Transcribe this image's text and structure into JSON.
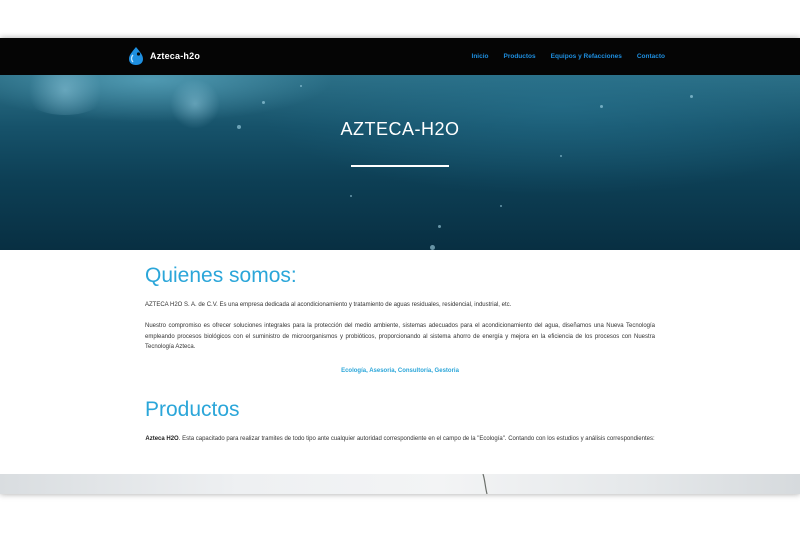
{
  "brand": {
    "name": "Azteca-h2o",
    "logo_icon": "water-drop-logo-icon"
  },
  "nav": {
    "items": [
      {
        "label": "Inicio"
      },
      {
        "label": "Productos"
      },
      {
        "label": "Equipos y Refacciones"
      },
      {
        "label": "Contacto"
      }
    ]
  },
  "hero": {
    "title": "AZTECA-H2O"
  },
  "about": {
    "heading": "Quienes somos:",
    "paragraph1": "AZTECA H2O S. A. de C.V. Es una empresa dedicada al acondicionamiento y tratamiento de aguas residuales, residencial, industrial, etc.",
    "paragraph2": "Nuestro compromiso es ofrecer soluciones integrales para la protección del medio ambiente, sistemas adecuados para el acondicionamiento del agua, diseñamos una Nueva Tecnología empleando procesos biológicos con el suministro de microorganismos y probióticos, proporcionando al sistema ahorro de energía y mejora en la eficiencia de los procesos con Nuestra Tecnología Azteca.",
    "tags": "Ecología, Asesoria, Consultoría, Gestoria"
  },
  "products": {
    "heading": "Productos",
    "intro_bold": "Azteca H2O",
    "intro_rest": ". Esta capacitado para realizar tramites de todo tipo ante cualquier autoridad correspondiente en el campo de la \"Ecología\". Contando con los estudios y análisis correspondientes:"
  },
  "colors": {
    "accent": "#2ba6d9",
    "nav_link": "#1e8fe0",
    "navbar_bg": "#050505",
    "hero_dark": "#082f42"
  }
}
